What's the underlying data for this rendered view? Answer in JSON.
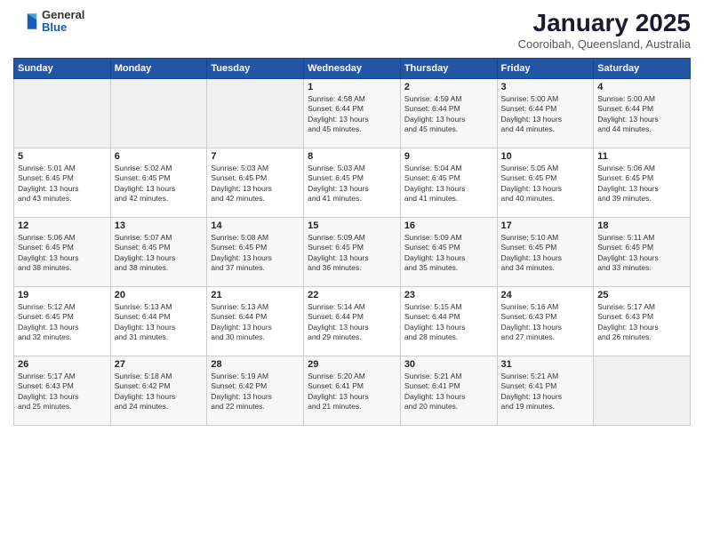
{
  "header": {
    "logo_general": "General",
    "logo_blue": "Blue",
    "title": "January 2025",
    "subtitle": "Cooroibah, Queensland, Australia"
  },
  "weekdays": [
    "Sunday",
    "Monday",
    "Tuesday",
    "Wednesday",
    "Thursday",
    "Friday",
    "Saturday"
  ],
  "weeks": [
    [
      {
        "day": "",
        "info": ""
      },
      {
        "day": "",
        "info": ""
      },
      {
        "day": "",
        "info": ""
      },
      {
        "day": "1",
        "info": "Sunrise: 4:58 AM\nSunset: 6:44 PM\nDaylight: 13 hours\nand 45 minutes."
      },
      {
        "day": "2",
        "info": "Sunrise: 4:59 AM\nSunset: 6:44 PM\nDaylight: 13 hours\nand 45 minutes."
      },
      {
        "day": "3",
        "info": "Sunrise: 5:00 AM\nSunset: 6:44 PM\nDaylight: 13 hours\nand 44 minutes."
      },
      {
        "day": "4",
        "info": "Sunrise: 5:00 AM\nSunset: 6:44 PM\nDaylight: 13 hours\nand 44 minutes."
      }
    ],
    [
      {
        "day": "5",
        "info": "Sunrise: 5:01 AM\nSunset: 6:45 PM\nDaylight: 13 hours\nand 43 minutes."
      },
      {
        "day": "6",
        "info": "Sunrise: 5:02 AM\nSunset: 6:45 PM\nDaylight: 13 hours\nand 42 minutes."
      },
      {
        "day": "7",
        "info": "Sunrise: 5:03 AM\nSunset: 6:45 PM\nDaylight: 13 hours\nand 42 minutes."
      },
      {
        "day": "8",
        "info": "Sunrise: 5:03 AM\nSunset: 6:45 PM\nDaylight: 13 hours\nand 41 minutes."
      },
      {
        "day": "9",
        "info": "Sunrise: 5:04 AM\nSunset: 6:45 PM\nDaylight: 13 hours\nand 41 minutes."
      },
      {
        "day": "10",
        "info": "Sunrise: 5:05 AM\nSunset: 6:45 PM\nDaylight: 13 hours\nand 40 minutes."
      },
      {
        "day": "11",
        "info": "Sunrise: 5:06 AM\nSunset: 6:45 PM\nDaylight: 13 hours\nand 39 minutes."
      }
    ],
    [
      {
        "day": "12",
        "info": "Sunrise: 5:06 AM\nSunset: 6:45 PM\nDaylight: 13 hours\nand 38 minutes."
      },
      {
        "day": "13",
        "info": "Sunrise: 5:07 AM\nSunset: 6:45 PM\nDaylight: 13 hours\nand 38 minutes."
      },
      {
        "day": "14",
        "info": "Sunrise: 5:08 AM\nSunset: 6:45 PM\nDaylight: 13 hours\nand 37 minutes."
      },
      {
        "day": "15",
        "info": "Sunrise: 5:09 AM\nSunset: 6:45 PM\nDaylight: 13 hours\nand 36 minutes."
      },
      {
        "day": "16",
        "info": "Sunrise: 5:09 AM\nSunset: 6:45 PM\nDaylight: 13 hours\nand 35 minutes."
      },
      {
        "day": "17",
        "info": "Sunrise: 5:10 AM\nSunset: 6:45 PM\nDaylight: 13 hours\nand 34 minutes."
      },
      {
        "day": "18",
        "info": "Sunrise: 5:11 AM\nSunset: 6:45 PM\nDaylight: 13 hours\nand 33 minutes."
      }
    ],
    [
      {
        "day": "19",
        "info": "Sunrise: 5:12 AM\nSunset: 6:45 PM\nDaylight: 13 hours\nand 32 minutes."
      },
      {
        "day": "20",
        "info": "Sunrise: 5:13 AM\nSunset: 6:44 PM\nDaylight: 13 hours\nand 31 minutes."
      },
      {
        "day": "21",
        "info": "Sunrise: 5:13 AM\nSunset: 6:44 PM\nDaylight: 13 hours\nand 30 minutes."
      },
      {
        "day": "22",
        "info": "Sunrise: 5:14 AM\nSunset: 6:44 PM\nDaylight: 13 hours\nand 29 minutes."
      },
      {
        "day": "23",
        "info": "Sunrise: 5:15 AM\nSunset: 6:44 PM\nDaylight: 13 hours\nand 28 minutes."
      },
      {
        "day": "24",
        "info": "Sunrise: 5:16 AM\nSunset: 6:43 PM\nDaylight: 13 hours\nand 27 minutes."
      },
      {
        "day": "25",
        "info": "Sunrise: 5:17 AM\nSunset: 6:43 PM\nDaylight: 13 hours\nand 26 minutes."
      }
    ],
    [
      {
        "day": "26",
        "info": "Sunrise: 5:17 AM\nSunset: 6:43 PM\nDaylight: 13 hours\nand 25 minutes."
      },
      {
        "day": "27",
        "info": "Sunrise: 5:18 AM\nSunset: 6:42 PM\nDaylight: 13 hours\nand 24 minutes."
      },
      {
        "day": "28",
        "info": "Sunrise: 5:19 AM\nSunset: 6:42 PM\nDaylight: 13 hours\nand 22 minutes."
      },
      {
        "day": "29",
        "info": "Sunrise: 5:20 AM\nSunset: 6:41 PM\nDaylight: 13 hours\nand 21 minutes."
      },
      {
        "day": "30",
        "info": "Sunrise: 5:21 AM\nSunset: 6:41 PM\nDaylight: 13 hours\nand 20 minutes."
      },
      {
        "day": "31",
        "info": "Sunrise: 5:21 AM\nSunset: 6:41 PM\nDaylight: 13 hours\nand 19 minutes."
      },
      {
        "day": "",
        "info": ""
      }
    ]
  ]
}
